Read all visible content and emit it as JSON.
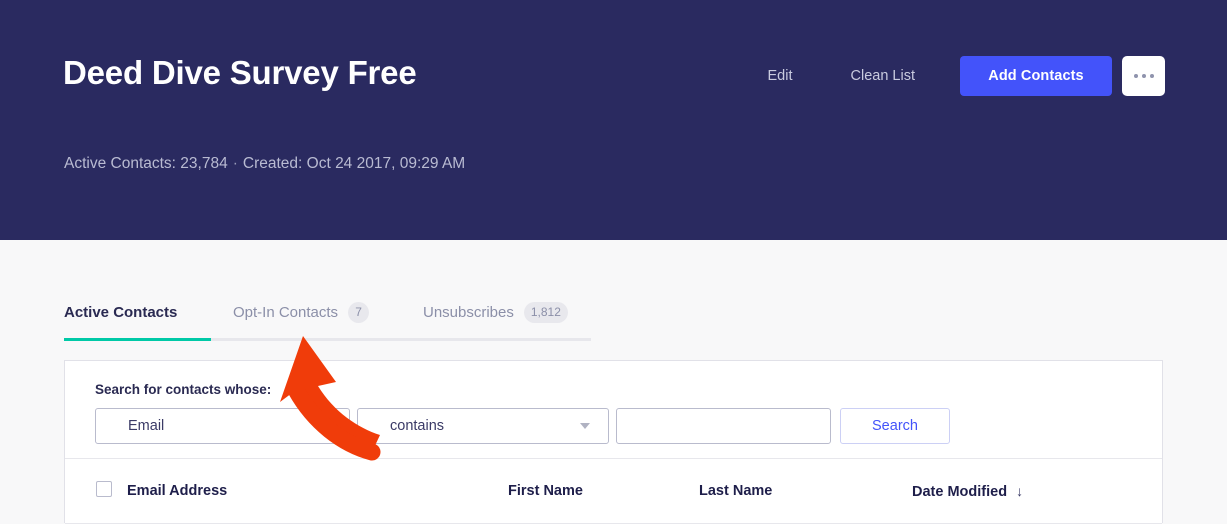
{
  "header": {
    "title": "Deed Dive Survey Free",
    "meta": {
      "active_contacts_label": "Active Contacts: 23,784",
      "separator": "·",
      "created_label": "Created: Oct 24 2017, 09:29 AM"
    },
    "actions": {
      "edit_label": "Edit",
      "clean_list_label": "Clean List",
      "add_contacts_label": "Add Contacts",
      "more_icon": "ellipsis-icon"
    },
    "background_color": "#2a2a60",
    "primary_button_color": "#4353fa"
  },
  "tabs": [
    {
      "label": "Active Contacts",
      "badge": "",
      "active": true
    },
    {
      "label": "Opt-In Contacts",
      "badge": "7",
      "active": false
    },
    {
      "label": "Unsubscribes",
      "badge": "1,812",
      "active": false
    }
  ],
  "tab_active_underline_color": "#00c9a7",
  "search": {
    "label": "Search for contacts whose:",
    "field_select": {
      "value": "Email",
      "caret_icon": "chevron-down-icon"
    },
    "operator_select": {
      "value": "contains",
      "caret_icon": "chevron-down-icon"
    },
    "term_input": {
      "value": "",
      "placeholder": ""
    },
    "search_button_label": "Search"
  },
  "table": {
    "select_all_checkbox": "checkbox-icon",
    "columns": [
      {
        "label": "Email Address",
        "sorted": false
      },
      {
        "label": "First Name",
        "sorted": false
      },
      {
        "label": "Last Name",
        "sorted": false
      },
      {
        "label": "Date Modified",
        "sorted": true,
        "sort_icon": "arrow-down-icon"
      }
    ],
    "sort_arrow_glyph": "↓"
  },
  "annotation": {
    "type": "arrow",
    "color": "#f03c0a",
    "points_to": "Opt-In Contacts tab"
  }
}
